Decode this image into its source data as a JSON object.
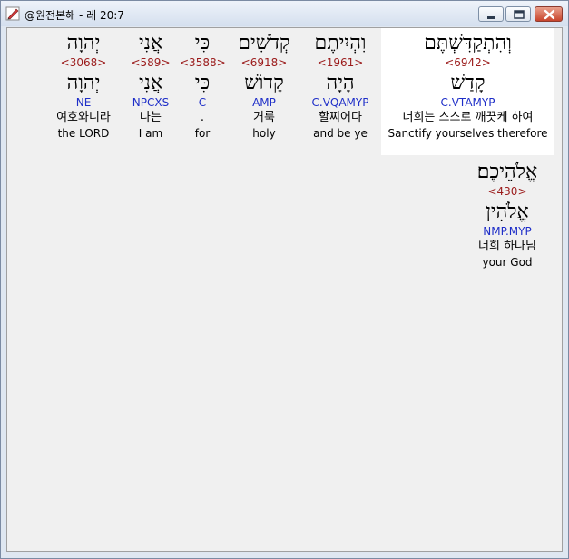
{
  "window": {
    "title": "@원전본해 - 레 20:7"
  },
  "words": [
    {
      "id": "w1",
      "hebrew": "וְהִתְקַדִּשְׁתֶּם",
      "strong": "<6942>",
      "lemma": "קָדַשׁ",
      "morph": "C.VTAMYP",
      "korean": "너희는 스스로 깨끗케 하여",
      "english": "Sanctify yourselves therefore",
      "highlighted": true
    },
    {
      "id": "w2",
      "hebrew": "וִהְיִיתֶם",
      "strong": "<1961>",
      "lemma": "הָיָה",
      "morph": "C.VQAMYP",
      "korean": "할찌어다",
      "english": "and be ye"
    },
    {
      "id": "w3",
      "hebrew": "קְדֹשִׁים",
      "strong": "<6918>",
      "lemma": "קָדוֹשׁ",
      "morph": "AMP",
      "korean": "거룩",
      "english": "holy"
    },
    {
      "id": "w4",
      "hebrew": "כִּי",
      "strong": "<3588>",
      "lemma": "כִּי",
      "morph": "C",
      "korean": ".",
      "english": "for"
    },
    {
      "id": "w5",
      "hebrew": "אֲנִי",
      "strong": "<589>",
      "lemma": "אֲנִי",
      "morph": "NPCXS",
      "korean": "나는",
      "english": "I am"
    },
    {
      "id": "w6",
      "hebrew": "יְהוָה",
      "strong": "<3068>",
      "lemma": "יְהוָה",
      "morph": "NE",
      "korean": "여호와니라",
      "english": "the LORD"
    },
    {
      "id": "w7",
      "hebrew": "אֱלֹהֵיכֶם׃",
      "strong": "<430>",
      "lemma": "אֱלֹהִין",
      "morph": "NMP.MYP",
      "korean": "너희 하나님",
      "english": "your God"
    }
  ]
}
